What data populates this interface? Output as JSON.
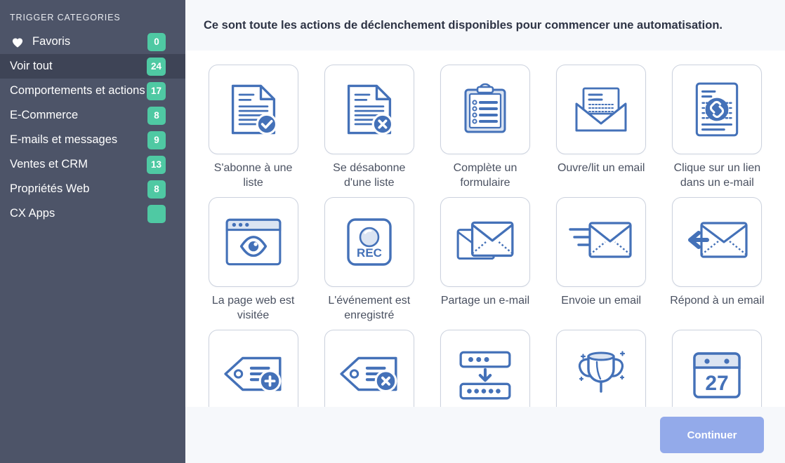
{
  "sidebar": {
    "title": "TRIGGER CATEGORIES",
    "items": [
      {
        "label": "Favoris",
        "badge": "0",
        "icon": "heart-icon",
        "active": false,
        "has_icon": true
      },
      {
        "label": "Voir tout",
        "badge": "24",
        "icon": "",
        "active": true,
        "has_icon": false
      },
      {
        "label": "Comportements et actions",
        "badge": "17",
        "icon": "",
        "active": false,
        "has_icon": false
      },
      {
        "label": "E-Commerce",
        "badge": "8",
        "icon": "",
        "active": false,
        "has_icon": false
      },
      {
        "label": "E-mails et messages",
        "badge": "9",
        "icon": "",
        "active": false,
        "has_icon": false
      },
      {
        "label": "Ventes et CRM",
        "badge": "13",
        "icon": "",
        "active": false,
        "has_icon": false
      },
      {
        "label": "Propriétés Web",
        "badge": "8",
        "icon": "",
        "active": false,
        "has_icon": false
      },
      {
        "label": "CX Apps",
        "badge": "",
        "icon": "",
        "active": false,
        "has_icon": false
      }
    ]
  },
  "header": {
    "text": "Ce sont toute les actions de déclenchement disponibles pour commencer une automatisation."
  },
  "footer": {
    "continue_label": "Continuer"
  },
  "colors": {
    "sidebar_bg": "#4d5468",
    "sidebar_active_bg": "#3e4456",
    "badge_green": "#4fc9a3",
    "icon_blue": "#4471b8",
    "icon_blue_light": "#dbe4f2",
    "header_bg": "#f6f8fb",
    "continue_button": "#93aaea",
    "card_border": "#ccd2de"
  },
  "triggers": [
    {
      "label": "S'abonne à une liste",
      "icon": "document-check-icon"
    },
    {
      "label": "Se désabonne d'une liste",
      "icon": "document-x-icon"
    },
    {
      "label": "Complète un formulaire",
      "icon": "clipboard-form-icon"
    },
    {
      "label": "Ouvre/lit un email",
      "icon": "open-envelope-icon"
    },
    {
      "label": "Clique sur un lien dans un e-mail",
      "icon": "document-link-icon"
    },
    {
      "label": "La page web est visitée",
      "icon": "browser-eye-icon"
    },
    {
      "label": "L'événement est enregistré",
      "icon": "record-rec-icon"
    },
    {
      "label": "Partage un e-mail",
      "icon": "share-envelope-icon"
    },
    {
      "label": "Envoie un email",
      "icon": "send-envelope-icon"
    },
    {
      "label": "Répond à un email",
      "icon": "reply-envelope-icon"
    },
    {
      "label": "",
      "icon": "tag-plus-icon"
    },
    {
      "label": "",
      "icon": "tag-x-icon"
    },
    {
      "label": "",
      "icon": "list-download-icon"
    },
    {
      "label": "",
      "icon": "trophy-icon"
    },
    {
      "label": "",
      "icon": "calendar-27-icon"
    }
  ]
}
